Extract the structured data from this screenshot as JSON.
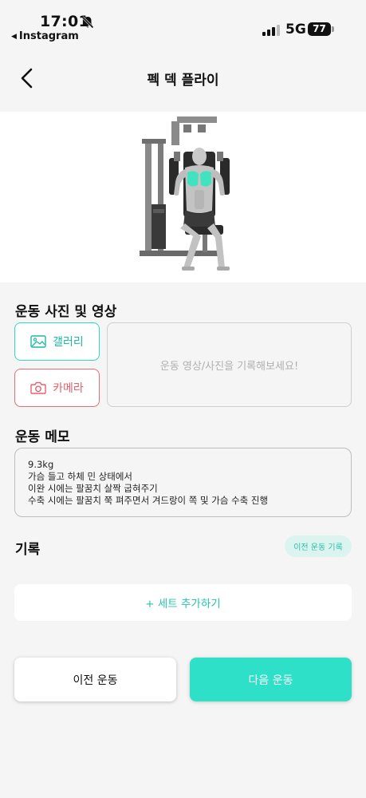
{
  "status_bar": {
    "time": "17:01",
    "back_app": "Instagram",
    "network": "5G",
    "battery": "77"
  },
  "header": {
    "title": "펙 덱 플라이"
  },
  "media_section": {
    "title": "운동 사진 및 영상",
    "gallery_label": "갤러리",
    "camera_label": "카메라",
    "placeholder": "운동 영상/사진을 기록해보세요!"
  },
  "memo_section": {
    "title": "운동 메모",
    "lines": [
      "9.3kg",
      "가슴 들고 하체 민 상태에서",
      "이완 시에는 팔꿈치 살짝 굽혀주기",
      "수축 시에는 팔꿈치 쭉 펴주면서 겨드랑이 쪽 및 가슴 수축 진행"
    ]
  },
  "record_section": {
    "title": "기록",
    "history_label": "이전 운동 기록",
    "add_set_label": "+ 세트 추가하기"
  },
  "footer": {
    "prev_label": "이전 운동",
    "next_label": "다음 운동"
  },
  "colors": {
    "accent": "#2fe0c8",
    "gallery": "#2fd8c2",
    "camera": "#ec6b76",
    "chip_bg": "#dcf4f0",
    "muscle_highlight": "#3fe3bf"
  },
  "icons": {
    "bell": "bell-slash-icon",
    "signal": "signal-bars-icon",
    "back": "chevron-left-icon",
    "gallery": "image-icon",
    "camera": "camera-icon"
  }
}
